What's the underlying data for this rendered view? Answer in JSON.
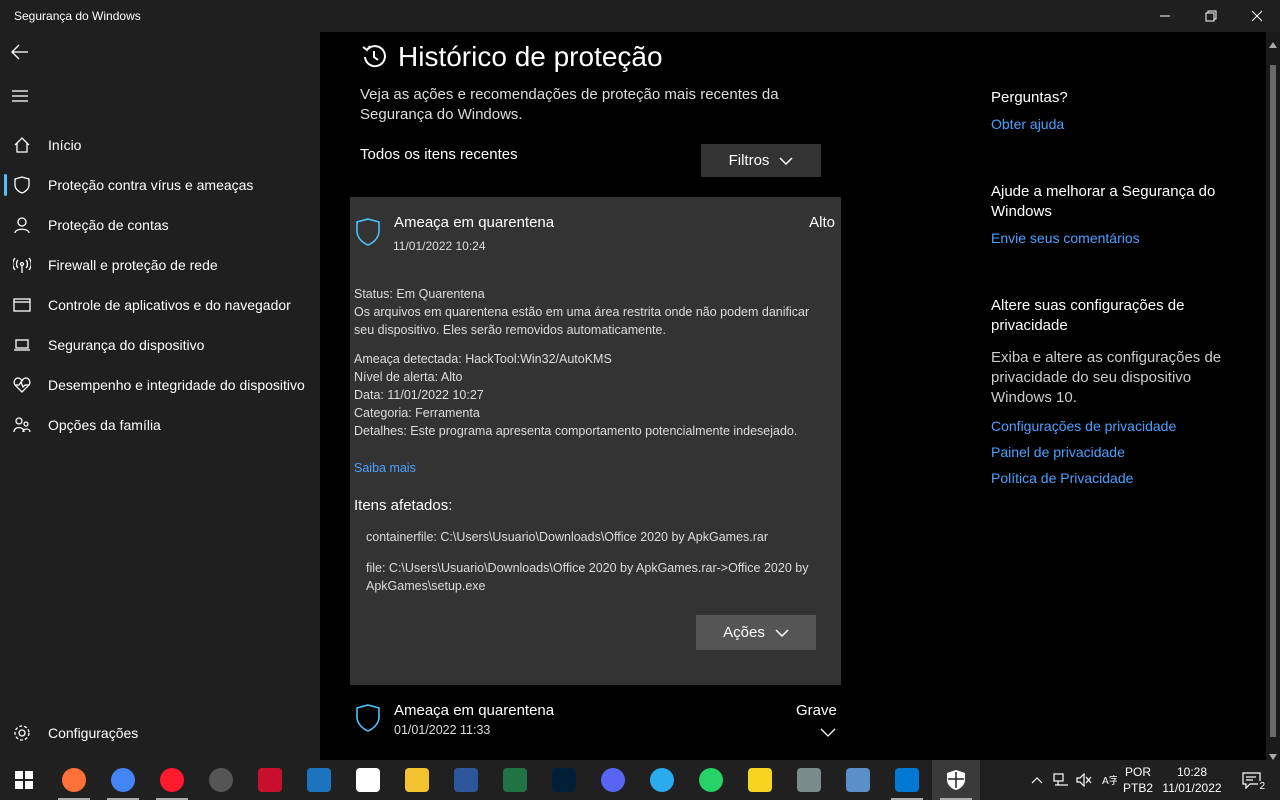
{
  "window": {
    "title": "Segurança do Windows"
  },
  "sidebar": {
    "items": [
      {
        "label": "Início"
      },
      {
        "label": "Proteção contra vírus e ameaças"
      },
      {
        "label": "Proteção de contas"
      },
      {
        "label": "Firewall e proteção de rede"
      },
      {
        "label": "Controle de aplicativos e do navegador"
      },
      {
        "label": "Segurança do dispositivo"
      },
      {
        "label": "Desempenho e integridade do dispositivo"
      },
      {
        "label": "Opções da família"
      }
    ],
    "settings_label": "Configurações"
  },
  "main": {
    "title": "Histórico de proteção",
    "description": "Veja as ações e recomendações de proteção mais recentes da Segurança do Windows.",
    "recent_label": "Todos os itens recentes",
    "filters_label": "Filtros",
    "card": {
      "title": "Ameaça em quarentena",
      "date": "11/01/2022 10:24",
      "severity": "Alto",
      "status_label": "Status:",
      "status_value": "Em Quarentena",
      "status_desc": "Os arquivos em quarentena estão em uma área restrita onde não podem danificar seu dispositivo. Eles serão removidos automaticamente.",
      "threat_label": "Ameaça detectada:",
      "threat_value": "HackTool:Win32/AutoKMS",
      "alert_label": "Nível de alerta:",
      "alert_value": "Alto",
      "date_label": "Data:",
      "date_value": "11/01/2022 10:27",
      "category_label": "Categoria:",
      "category_value": "Ferramenta",
      "details_label": "Detalhes:",
      "details_value": "Este programa apresenta comportamento potencialmente indesejado.",
      "learn_more": "Saiba mais",
      "affected_title": "Itens afetados:",
      "affected_1": "containerfile: C:\\Users\\Usuario\\Downloads\\Office 2020 by ApkGames.rar",
      "affected_2": "file: C:\\Users\\Usuario\\Downloads\\Office 2020 by ApkGames.rar->Office 2020 by ApkGames\\setup.exe",
      "actions_label": "Ações"
    },
    "card2": {
      "title": "Ameaça em quarentena",
      "date": "01/01/2022 11:33",
      "severity": "Grave"
    }
  },
  "right": {
    "questions_head": "Perguntas?",
    "get_help": "Obter ajuda",
    "improve_head": "Ajude a melhorar a Segurança do Windows",
    "feedback": "Envie seus comentários",
    "privacy_head": "Altere suas configurações de privacidade",
    "privacy_text": "Exiba e altere as configurações de privacidade do seu dispositivo Windows 10.",
    "privacy_settings": "Configurações de privacidade",
    "privacy_dashboard": "Painel de privacidade",
    "privacy_policy": "Política de Privacidade"
  },
  "taskbar": {
    "lang_1": "POR",
    "lang_2": "PTB2",
    "time": "10:28",
    "date": "11/01/2022",
    "notif_count": "2",
    "apps": [
      {
        "name": "firefox",
        "color": "#ff7139"
      },
      {
        "name": "chrome",
        "color": "#4285f4"
      },
      {
        "name": "opera",
        "color": "#ff1b2d"
      },
      {
        "name": "obs",
        "color": "#555555"
      },
      {
        "name": "autocad",
        "color": "#c8102e"
      },
      {
        "name": "bim",
        "color": "#1e73be"
      },
      {
        "name": "bim-sight",
        "color": "#ffffff"
      },
      {
        "name": "explorer",
        "color": "#f4c430"
      },
      {
        "name": "word",
        "color": "#2b579a"
      },
      {
        "name": "excel",
        "color": "#217346"
      },
      {
        "name": "photoshop",
        "color": "#001e36"
      },
      {
        "name": "discord",
        "color": "#5865f2"
      },
      {
        "name": "telegram",
        "color": "#2aabee"
      },
      {
        "name": "whatsapp",
        "color": "#25d366"
      },
      {
        "name": "sticky-notes",
        "color": "#f7d51e"
      },
      {
        "name": "app-window",
        "color": "#7a8b8c"
      },
      {
        "name": "control-panel",
        "color": "#5a8fc8"
      },
      {
        "name": "vscode",
        "color": "#0078d4"
      },
      {
        "name": "windows-security",
        "color": "#ffffff"
      }
    ]
  }
}
